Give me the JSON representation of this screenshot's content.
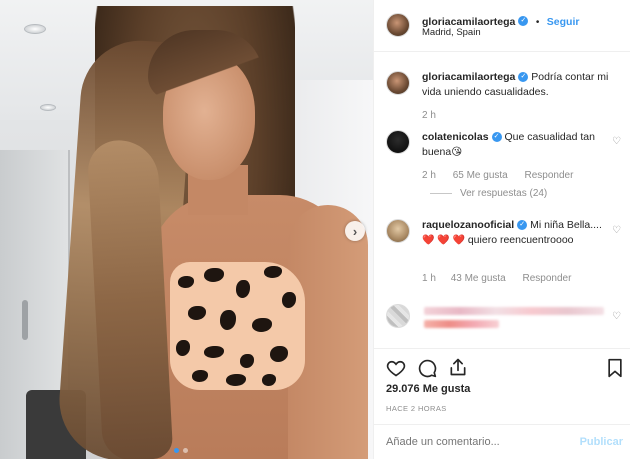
{
  "header": {
    "username": "gloriacamilaortega",
    "follow_label": "Seguir",
    "location": "Madrid, Spain",
    "separator": "•"
  },
  "caption": {
    "username": "gloriacamilaortega",
    "text": "Podría contar mi vida uniendo casualidades.",
    "time": "2 h"
  },
  "comments": [
    {
      "username": "colatenicolas",
      "text": "Que casualidad tan buena😘",
      "time": "2 h",
      "likes": "65 Me gusta",
      "reply": "Responder",
      "view_replies": "Ver respuestas (24)"
    },
    {
      "username": "raquelozanooficial",
      "text_before": "Mi niña Bella....",
      "text_after": "quiero reencuentroooo",
      "time": "1 h",
      "likes": "43 Me gusta",
      "reply": "Responder"
    }
  ],
  "post": {
    "likes": "29.076 Me gusta",
    "timestamp": "HACE 2 HORAS"
  },
  "comment_box": {
    "placeholder": "Añade un comentario...",
    "publish_label": "Publicar"
  },
  "icons": {
    "like": "heart-icon",
    "comment": "comment-icon",
    "share": "share-icon",
    "save": "bookmark-icon",
    "next": "chevron-right-icon"
  },
  "colors": {
    "accent": "#3897f0",
    "publish_disabled": "#b2dffc",
    "muted": "#8e8e8e",
    "heart_red": "#ed4956"
  }
}
